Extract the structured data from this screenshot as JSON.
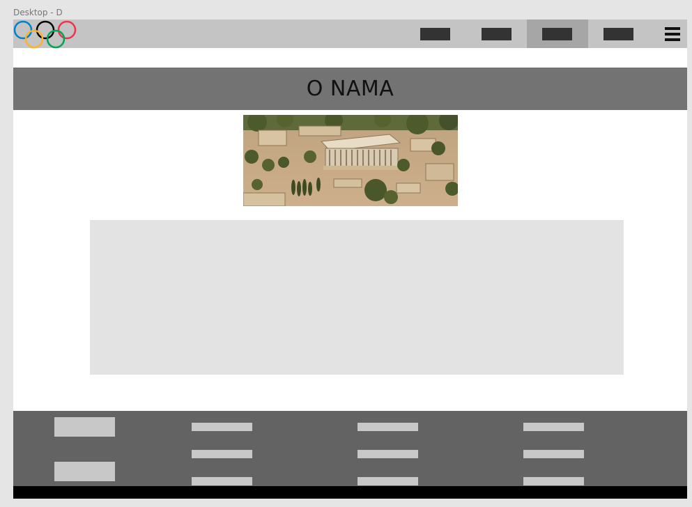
{
  "canvas": {
    "frame_label": "Desktop - D"
  },
  "header": {
    "logo": {
      "icon": "olympic-rings-icon",
      "colors": [
        "#0081c8",
        "#000000",
        "#ee334e",
        "#fcb131",
        "#00a651"
      ]
    },
    "nav_items": [
      {
        "icon": "nav-placeholder-icon",
        "active": false
      },
      {
        "icon": "nav-placeholder-icon",
        "active": false
      },
      {
        "icon": "nav-placeholder-icon",
        "active": true
      },
      {
        "icon": "nav-placeholder-icon",
        "active": false
      }
    ],
    "menu_icon": "hamburger-menu-icon"
  },
  "main": {
    "title": "O NAMA",
    "hero_image": {
      "icon": "ancient-temple-photo"
    }
  },
  "footer": {
    "columns": 4
  },
  "colors": {
    "navbar": "#c4c4c4",
    "nav_active": "#a6a6a6",
    "banner": "#737373",
    "content_box": "#e3e3e3",
    "footer": "#636363",
    "bottom_bar": "#000000"
  }
}
